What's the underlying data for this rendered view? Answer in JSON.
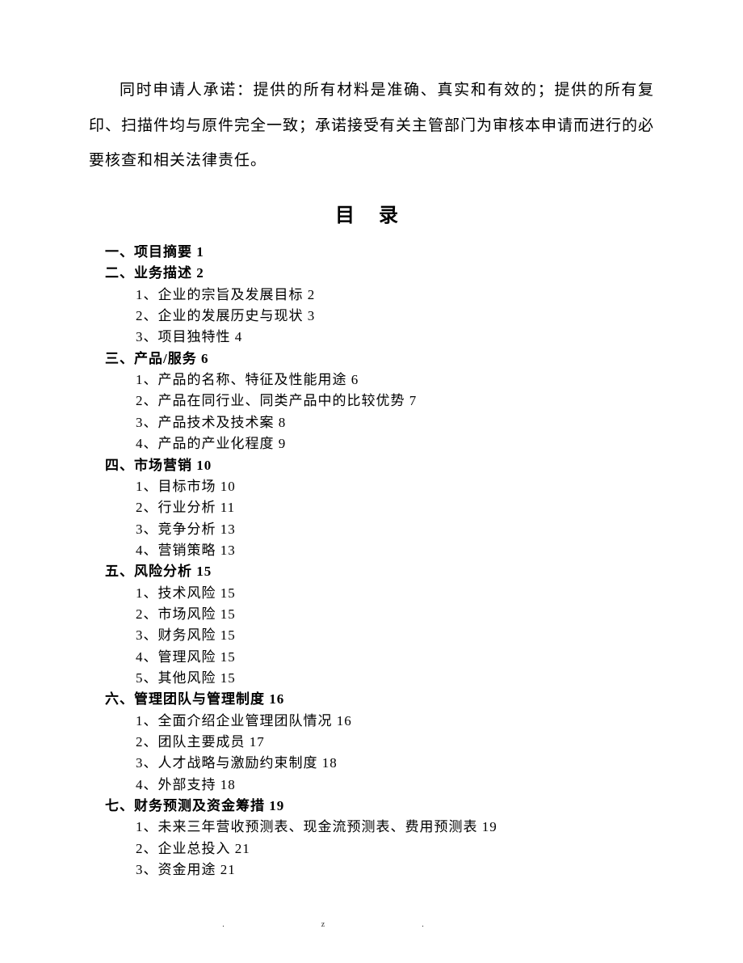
{
  "paragraph": "同时申请人承诺：提供的所有材料是准确、真实和有效的；提供的所有复印、扫描件均与原件完全一致；承诺接受有关主管部门为审核本申请而进行的必要核查和相关法律责任。",
  "toc_title": "目 录",
  "toc": [
    {
      "num": "一、",
      "title": "项目摘要",
      "page": "1",
      "subs": []
    },
    {
      "num": "二、",
      "title": "业务描述",
      "page": "2",
      "subs": [
        {
          "num": "1、",
          "title": "企业的宗旨及发展目标",
          "page": "2"
        },
        {
          "num": "2、",
          "title": "企业的发展历史与现状",
          "page": "3"
        },
        {
          "num": "3、",
          "title": "项目独特性",
          "page": "4"
        }
      ]
    },
    {
      "num": "三、",
      "title": "产品/服务",
      "page": "6",
      "subs": [
        {
          "num": "1、",
          "title": "产品的名称、特征及性能用途",
          "page": "6"
        },
        {
          "num": "2、",
          "title": "产品在同行业、同类产品中的比较优势",
          "page": "7"
        },
        {
          "num": "3、",
          "title": "产品技术及技术案",
          "page": "8"
        },
        {
          "num": "4、",
          "title": "产品的产业化程度",
          "page": "9"
        }
      ]
    },
    {
      "num": "四、",
      "title": "市场营销",
      "page": "10",
      "subs": [
        {
          "num": "1、",
          "title": "目标市场",
          "page": "10"
        },
        {
          "num": "2、",
          "title": "行业分析",
          "page": "11"
        },
        {
          "num": "3、",
          "title": "竞争分析",
          "page": "13"
        },
        {
          "num": "4、",
          "title": "营销策略",
          "page": "13"
        }
      ]
    },
    {
      "num": "五、",
      "title": "风险分析",
      "page": "15",
      "subs": [
        {
          "num": "1、",
          "title": "技术风险",
          "page": "15"
        },
        {
          "num": "2、",
          "title": "市场风险",
          "page": "15"
        },
        {
          "num": "3、",
          "title": "财务风险",
          "page": "15"
        },
        {
          "num": "4、",
          "title": "管理风险",
          "page": "15"
        },
        {
          "num": "5、",
          "title": "其他风险",
          "page": "15"
        }
      ]
    },
    {
      "num": "六、",
      "title": "管理团队与管理制度",
      "page": "16",
      "subs": [
        {
          "num": "1、",
          "title": "全面介绍企业管理团队情况",
          "page": "16"
        },
        {
          "num": "2、",
          "title": "团队主要成员",
          "page": "17"
        },
        {
          "num": "3、",
          "title": "人才战略与激励约束制度",
          "page": "18"
        },
        {
          "num": "4、",
          "title": "外部支持",
          "page": "18"
        }
      ]
    },
    {
      "num": "七、",
      "title": "财务预测及资金筹措",
      "page": "19",
      "subs": [
        {
          "num": "1、",
          "title": "未来三年营收预测表、现金流预测表、费用预测表",
          "page": "19"
        },
        {
          "num": "2、",
          "title": "企业总投入",
          "page": "21"
        },
        {
          "num": "3、",
          "title": "资金用途",
          "page": "21"
        }
      ]
    }
  ],
  "footer_left": ".",
  "footer_right": "z."
}
